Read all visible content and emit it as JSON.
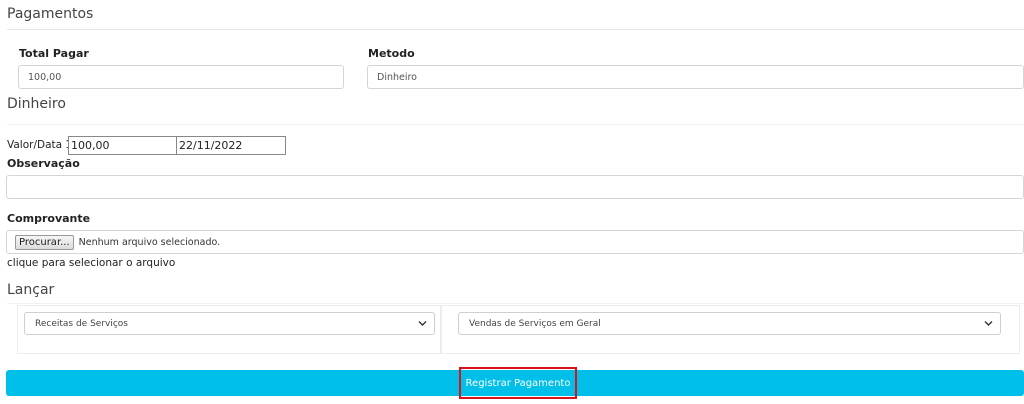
{
  "header": {
    "title": "Pagamentos"
  },
  "total": {
    "label": "Total Pagar",
    "value": "100,00"
  },
  "metodo": {
    "label": "Metodo",
    "value": "Dinheiro"
  },
  "dinheiro": {
    "title": "Dinheiro",
    "row_label": "Valor/Data 1:",
    "valor": "100,00",
    "data": "22/11/2022"
  },
  "observacao": {
    "label": "Observação",
    "value": ""
  },
  "comprovante": {
    "label": "Comprovante",
    "button_label": "Procurar...",
    "file_status": "Nenhum arquivo selecionado.",
    "hint": "clique para selecionar o arquivo"
  },
  "lancar": {
    "title": "Lançar",
    "select1": "Receitas de Serviços",
    "select2": "Vendas de Serviços em Geral"
  },
  "submit": {
    "label": "Registrar Pagamento"
  },
  "colors": {
    "accent": "#00bfe9",
    "highlight": "#d8141a"
  }
}
